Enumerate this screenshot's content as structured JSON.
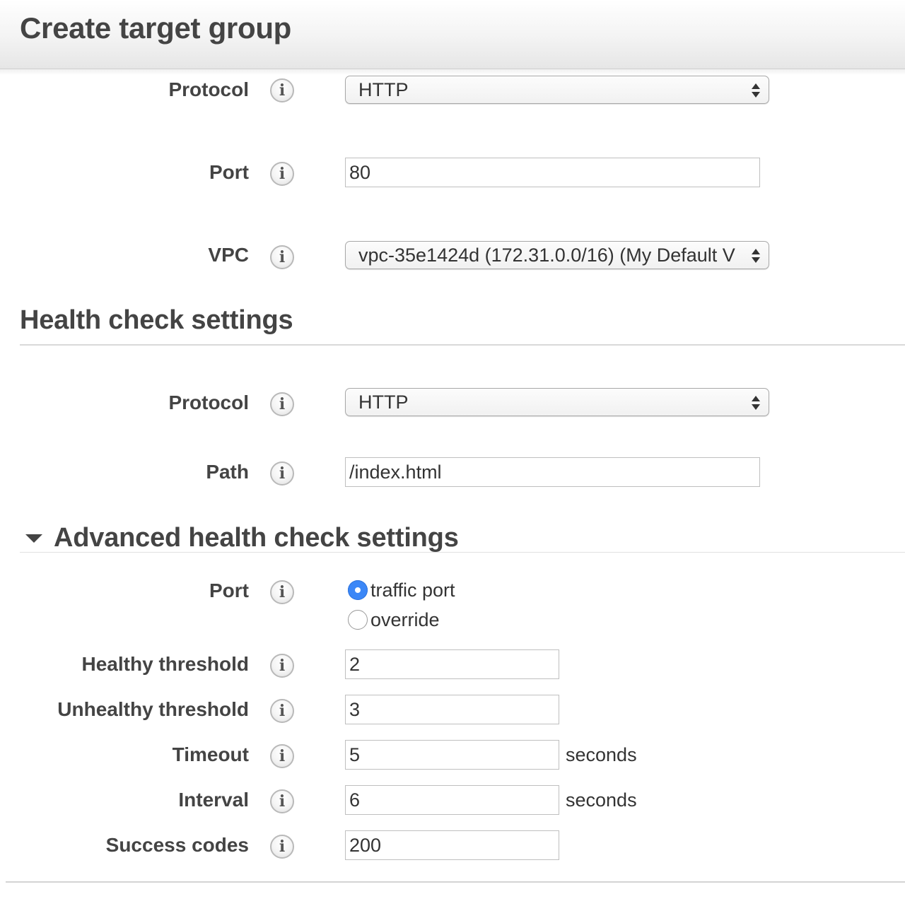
{
  "header": {
    "title": "Create target group"
  },
  "target": {
    "protocol": {
      "label": "Protocol",
      "value": "HTTP"
    },
    "port": {
      "label": "Port",
      "value": "80"
    },
    "vpc": {
      "label": "VPC",
      "value": "vpc-35e1424d (172.31.0.0/16) (My Default V"
    }
  },
  "health": {
    "title": "Health check settings",
    "protocol": {
      "label": "Protocol",
      "value": "HTTP"
    },
    "path": {
      "label": "Path",
      "value": "/index.html"
    }
  },
  "advanced": {
    "title": "Advanced health check settings",
    "port": {
      "label": "Port",
      "options": [
        {
          "label": "traffic port",
          "selected": true
        },
        {
          "label": "override",
          "selected": false
        }
      ]
    },
    "healthy_threshold": {
      "label": "Healthy threshold",
      "value": "2"
    },
    "unhealthy_threshold": {
      "label": "Unhealthy threshold",
      "value": "3"
    },
    "timeout": {
      "label": "Timeout",
      "value": "5",
      "unit": "seconds"
    },
    "interval": {
      "label": "Interval",
      "value": "6",
      "unit": "seconds"
    },
    "success_codes": {
      "label": "Success codes",
      "value": "200"
    }
  },
  "icons": {
    "info": "info-icon",
    "select_arrows": "select-arrows-icon",
    "collapse": "caret-down-icon"
  },
  "info_glyph": "i",
  "colors": {
    "radio_selected": "#3b87f7",
    "text": "#444444",
    "border": "#bfbfbf"
  }
}
